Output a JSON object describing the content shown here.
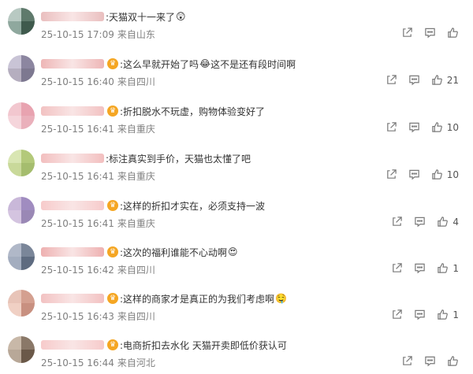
{
  "comments": [
    {
      "text": ":天猫双十一来了",
      "emoji": "😲",
      "has_badge": false,
      "date": "25-10-15 17:09",
      "location": "来自山东",
      "like_count": "",
      "avatar_colors": [
        "#b8c9c2",
        "#5f7a6c",
        "#8fa89e",
        "#3f5a4d"
      ],
      "name_color": "#d88a8a"
    },
    {
      "text": ":这么早就开始了吗",
      "emoji": "😂",
      "text2": "这不是还有段时间啊",
      "has_badge": true,
      "date": "25-10-15 16:40",
      "location": "来自四川",
      "like_count": "21",
      "avatar_colors": [
        "#c9c4d6",
        "#8c86a0",
        "#b5aebf",
        "#7d7890"
      ],
      "name_color": "#e07a7a"
    },
    {
      "text": ":折扣脱水不玩虚，购物体验变好了",
      "emoji": "",
      "has_badge": true,
      "date": "25-10-15 16:41",
      "location": "来自重庆",
      "like_count": "10",
      "avatar_colors": [
        "#f2c7cf",
        "#e8a3b0",
        "#f5d5db",
        "#eab0bb"
      ],
      "name_color": "#e89090"
    },
    {
      "text": ":标注真实到手价，天猫也太懂了吧",
      "emoji": "",
      "has_badge": false,
      "date": "25-10-15 16:41",
      "location": "来自重庆",
      "like_count": "10",
      "avatar_colors": [
        "#d9e6b3",
        "#b3c97a",
        "#c9d99a",
        "#a5bd6e"
      ],
      "name_color": "#e88a8a"
    },
    {
      "text": ":这样的折扣才实在，必须支持一波",
      "emoji": "",
      "has_badge": true,
      "date": "25-10-15 16:41",
      "location": "来自重庆",
      "like_count": "4",
      "avatar_colors": [
        "#c9b8d9",
        "#a08cc0",
        "#d4c4e0",
        "#9a88b5"
      ],
      "name_color": "#f0a0a0"
    },
    {
      "text": ":这次的福利谁能不心动啊",
      "emoji": "😍",
      "has_badge": true,
      "date": "25-10-15 16:42",
      "location": "来自四川",
      "like_count": "1",
      "avatar_colors": [
        "#b0b8c8",
        "#7a8699",
        "#a3adbf",
        "#5e6b80"
      ],
      "name_color": "#e07070"
    },
    {
      "text": ":这样的商家才是真正的为我们考虑啊",
      "emoji": "🤤",
      "has_badge": true,
      "date": "25-10-15 16:43",
      "location": "来自四川",
      "like_count": "1",
      "avatar_colors": [
        "#e8c4b8",
        "#d4a090",
        "#f0d0c4",
        "#c89080"
      ],
      "name_color": "#e89090"
    },
    {
      "text": ":电商折扣去水化 天猫开卖即低价获认可",
      "emoji": "",
      "has_badge": true,
      "date": "25-10-15 16:44",
      "location": "来自河北",
      "like_count": "",
      "avatar_colors": [
        "#c8b8a8",
        "#8a7868",
        "#b8a898",
        "#6a5848"
      ],
      "name_color": "#f0a0a0"
    }
  ],
  "icons": {
    "share": "share-icon",
    "comment": "comment-icon",
    "like": "like-icon"
  }
}
